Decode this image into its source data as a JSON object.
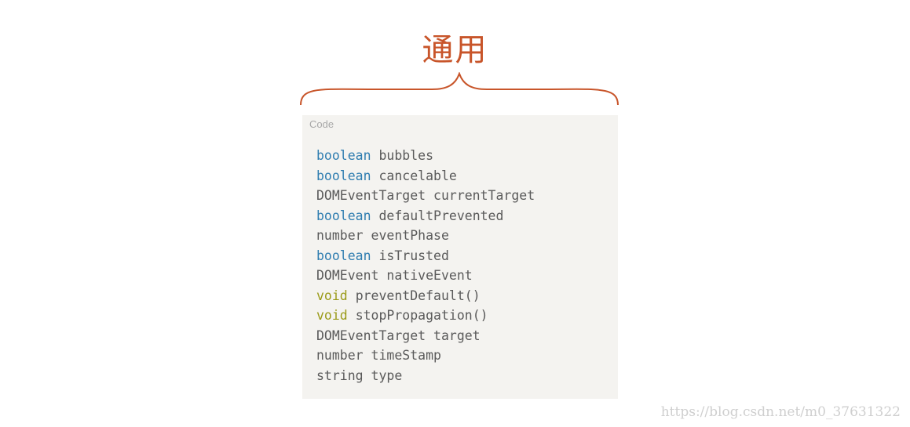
{
  "heading": "通用",
  "code_block": {
    "caption": "Code",
    "lines": [
      {
        "type": "boolean",
        "name": "bubbles"
      },
      {
        "type": "boolean",
        "name": "cancelable"
      },
      {
        "type": "DOMEventTarget",
        "name": "currentTarget"
      },
      {
        "type": "boolean",
        "name": "defaultPrevented"
      },
      {
        "type": "number",
        "name": "eventPhase"
      },
      {
        "type": "boolean",
        "name": "isTrusted"
      },
      {
        "type": "DOMEvent",
        "name": "nativeEvent"
      },
      {
        "type": "void",
        "name": "preventDefault()"
      },
      {
        "type": "void",
        "name": "stopPropagation()"
      },
      {
        "type": "DOMEventTarget",
        "name": "target"
      },
      {
        "type": "number",
        "name": "timeStamp"
      },
      {
        "type": "string",
        "name": "type"
      }
    ]
  },
  "watermark": "https://blog.csdn.net/m0_37631322",
  "colors": {
    "heading": "#c8552a",
    "brace": "#c8552a",
    "keyword_boolean": "#2f7db0",
    "keyword_void": "#9a9a18",
    "code_text": "#5a5a5a",
    "code_background": "#f4f3f0"
  }
}
